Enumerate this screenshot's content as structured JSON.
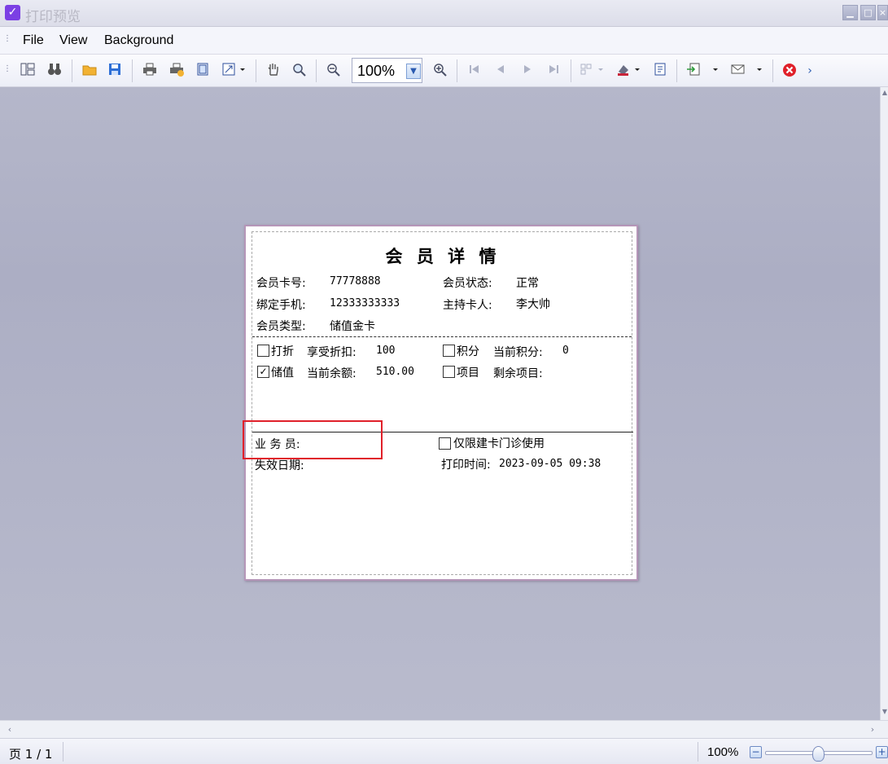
{
  "window": {
    "title": "打印预览"
  },
  "menu": {
    "file": "File",
    "view": "View",
    "background": "Background"
  },
  "toolbar": {
    "zoom_value": "100%",
    "icons": [
      "toggle-panel-icon",
      "find-icon",
      "open-icon",
      "save-icon",
      "print-icon",
      "quick-print-icon",
      "page-setup-icon",
      "scale-icon",
      "hand-tool-icon",
      "magnifier-icon",
      "zoom-out-icon",
      "zoom-in-icon",
      "first-page-icon",
      "previous-page-icon",
      "next-page-icon",
      "last-page-icon",
      "multiple-pages-icon",
      "color-icon",
      "watermark-icon",
      "export-icon",
      "send-email-icon",
      "close-preview-icon"
    ]
  },
  "document": {
    "title": "会 员 详 情",
    "card_no_label": "会员卡号:",
    "card_no_value": "77778888",
    "status_label": "会员状态:",
    "status_value": "正常",
    "phone_label": "绑定手机:",
    "phone_value": "12333333333",
    "holder_label": "主持卡人:",
    "holder_value": "李大帅",
    "type_label": "会员类型:",
    "type_value": "储值金卡",
    "discount_check_label": "打折",
    "discount_label": "享受折扣:",
    "discount_value": "100",
    "discount_checked": false,
    "points_check_label": "积分",
    "points_label": "当前积分:",
    "points_value": "0",
    "points_checked": false,
    "stored_check_label": "储值",
    "balance_label": "当前余额:",
    "balance_value": "510.00",
    "stored_checked": true,
    "items_check_label": "项目",
    "items_label": "剩余项目:",
    "items_checked": false,
    "salesman_label": "业 务 员:",
    "clinic_only_label": "仅限建卡门诊使用",
    "clinic_only_checked": false,
    "expiry_label": "失效日期:",
    "print_time_label": "打印时间:",
    "print_time_value": "2023-09-05 09:38"
  },
  "status": {
    "page_indicator": "页 1 / 1",
    "zoom_percent": "100%",
    "zoom_level": 1.0
  },
  "colors": {
    "highlight": "#e0202a",
    "accent": "#7b3fe4",
    "close": "#e0202a"
  }
}
